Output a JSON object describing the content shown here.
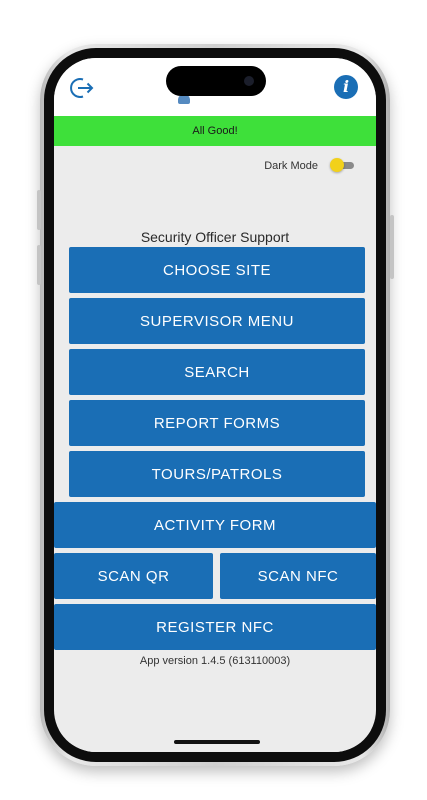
{
  "app": {
    "status_text": "All Good!",
    "dark_mode_label": "Dark Mode",
    "dark_mode_on": true,
    "subtitle": "Security Officer Support",
    "version_text": "App version 1.4.5 (613110003)"
  },
  "header": {
    "logout_icon": "logout-icon",
    "info_icon": "info-icon",
    "info_glyph": "i"
  },
  "menu": {
    "choose_site": "CHOOSE SITE",
    "supervisor_menu": "SUPERVISOR MENU",
    "search": "SEARCH",
    "report_forms": "REPORT FORMS",
    "tours_patrols": "TOURS/PATROLS",
    "activity_form": "ACTIVITY FORM",
    "scan_qr": "SCAN QR",
    "scan_nfc": "SCAN NFC",
    "register_nfc": "REGISTER NFC"
  },
  "colors": {
    "primary": "#1a6eb5",
    "status_ok": "#3ee03a",
    "toggle_knob": "#f2d11b",
    "screen_bg": "#ececec"
  }
}
